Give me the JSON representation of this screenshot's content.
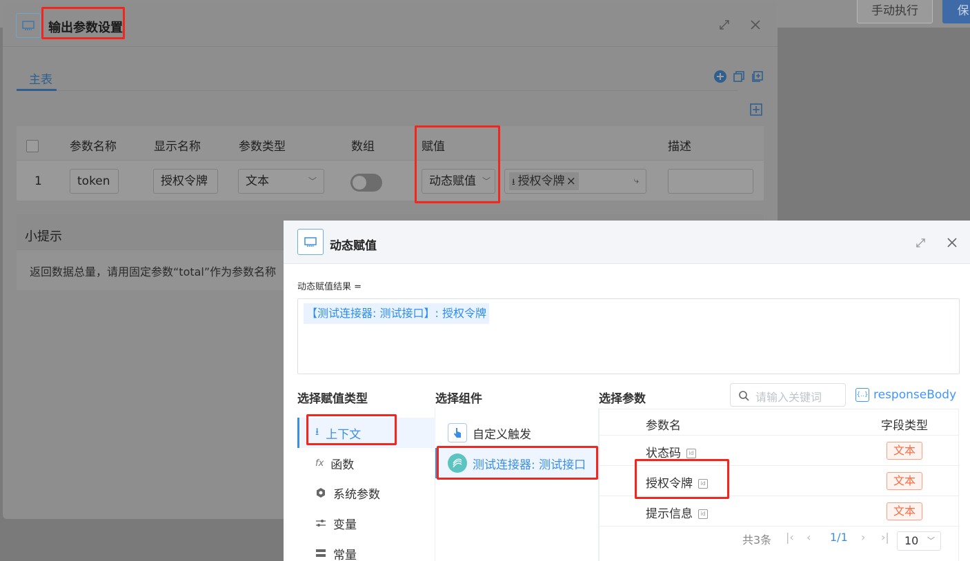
{
  "topbar": {
    "manual_exec": "手动执行",
    "save": "保"
  },
  "output_modal": {
    "title": "输出参数设置",
    "tab_main": "主表",
    "columns": [
      "参数名称",
      "显示名称",
      "参数类型",
      "数组",
      "赋值",
      "描述"
    ],
    "row": {
      "index": "1",
      "param_name": "token",
      "display_name": "授权令牌",
      "param_type": "文本",
      "assign_mode": "动态赋值",
      "assign_value_tag": "授权令牌"
    },
    "tips_title": "小提示",
    "tips_text": "返回数据总量，请用固定参数“total”作为参数名称"
  },
  "dynamic_modal": {
    "title": "动态赋值",
    "result_label": "动态赋值结果 =",
    "result_tag": "【测试连接器: 测试接口】: 授权令牌",
    "section_type": "选择赋值类型",
    "section_component": "选择组件",
    "section_param": "选择参数",
    "search_placeholder": "请输入关键词",
    "response_body": "responseBody",
    "types": [
      {
        "label": "上下文",
        "icon": "context-icon"
      },
      {
        "label": "函数",
        "icon": "function-icon"
      },
      {
        "label": "系统参数",
        "icon": "system-param-icon"
      },
      {
        "label": "变量",
        "icon": "variable-icon"
      },
      {
        "label": "常量",
        "icon": "constant-icon"
      }
    ],
    "components": [
      {
        "label": "自定义触发",
        "icon": "custom-trigger-icon"
      },
      {
        "label": "测试连接器: 测试接口",
        "icon": "connector-icon"
      }
    ],
    "param_table": {
      "col_name": "参数名",
      "col_type": "字段类型",
      "rows": [
        {
          "name": "状态码",
          "type": "文本"
        },
        {
          "name": "授权令牌",
          "type": "文本"
        },
        {
          "name": "提示信息",
          "type": "文本"
        }
      ],
      "total": "共3条",
      "page": "1/1",
      "page_size": "10"
    }
  },
  "colors": {
    "highlight": "#f2261c",
    "accent": "#3a8ee6",
    "tag_orange": "#f56c45"
  }
}
